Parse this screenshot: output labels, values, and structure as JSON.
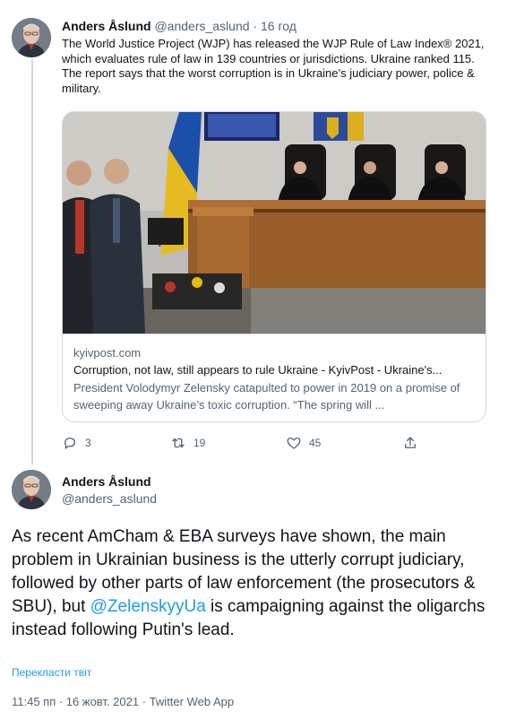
{
  "tweet1": {
    "author_name": "Anders Åslund",
    "author_handle": "@anders_aslund",
    "separator": "·",
    "time": "16 год",
    "text": "The World Justice Project (WJP) has released the WJP Rule of Law Index® 2021, which evaluates rule of law in 139 countries or jurisdictions. Ukraine ranked 115. The report says that the worst corruption is in Ukraine’s judiciary power, police & military.",
    "card": {
      "domain": "kyivpost.com",
      "title": "Corruption, not law, still appears to rule Ukraine - KyivPost - Ukraine's...",
      "description": "President Volodymyr Zelensky catapulted to power in 2019 on a promise of sweeping away Ukraine’s toxic corruption. “The spring will ..."
    },
    "actions": {
      "replies": "3",
      "retweets": "19",
      "likes": "45"
    }
  },
  "tweet2": {
    "author_name": "Anders Åslund",
    "author_handle": "@anders_aslund",
    "text_before": "As recent AmCham & EBA surveys have shown, the main problem in Ukrainian business is the utterly corrupt judiciary, followed by other parts of law enforcement (the prosecutors & SBU), but ",
    "mention": "@ZelenskyyUa",
    "text_after": " is campaigning against the oligarchs instead following Putin's lead.",
    "translate_label": "Перекласти твіт",
    "timestamp": "11:45 пп · 16 жовт. 2021",
    "separator": "·",
    "source": "Twitter Web App"
  },
  "colors": {
    "accent": "#1d9bf0",
    "secondary_text": "#536471",
    "border": "#cfd9de"
  },
  "icons": [
    "reply-icon",
    "retweet-icon",
    "like-icon",
    "share-icon"
  ]
}
